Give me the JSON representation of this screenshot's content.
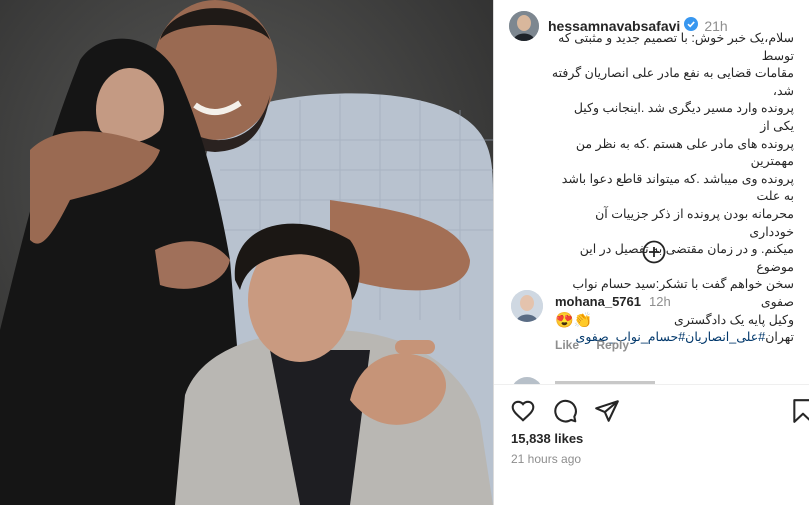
{
  "post": {
    "username": "hessamnavabsafavi",
    "time_ago": "21h",
    "caption_lines": [
      "سلام،یک خبر خوش: با تصمیم جدید و مثبتی که توسط",
      "مقامات قضایی به نفع مادر علی انصاریان گرفته شد،",
      "پرونده وارد مسیر دیگری شد .اینجانب وکیل یکی از",
      "پرونده های مادر علی هستم .که به نظر من مهمترین",
      "پرونده وی میباشد .که میتواند قاطع دعوا باشد به علت",
      "محرمانه بودن پرونده از ذکر جزییات آن خودداری",
      "میکنم. و در زمان مقتضی به تفصیل در این موضوع",
      "سخن خواهم گفت با تشکر:سید حسام نواب صفوی",
      "وکیل پایه یک دادگستری"
    ],
    "caption_tail": "تهران",
    "hashtags": "#علی_انصاریان#حسام_نواب_صفوی",
    "likes": "15,838 likes",
    "posted_ago": "21 hours ago"
  },
  "comments": [
    {
      "username": "mohana_5761",
      "time_ago": "12h",
      "text": "😍👏",
      "like_label": "Like",
      "reply_label": "Reply"
    }
  ],
  "icons": {
    "verified": "verified-badge-icon",
    "load_more": "plus-circle-icon",
    "like": "heart-icon",
    "comment": "comment-icon",
    "share": "share-icon",
    "save": "bookmark-icon"
  },
  "colors": {
    "verified": "#3897f0",
    "hashtag": "#00376b",
    "muted": "#8e8e8e",
    "text": "#262626"
  }
}
